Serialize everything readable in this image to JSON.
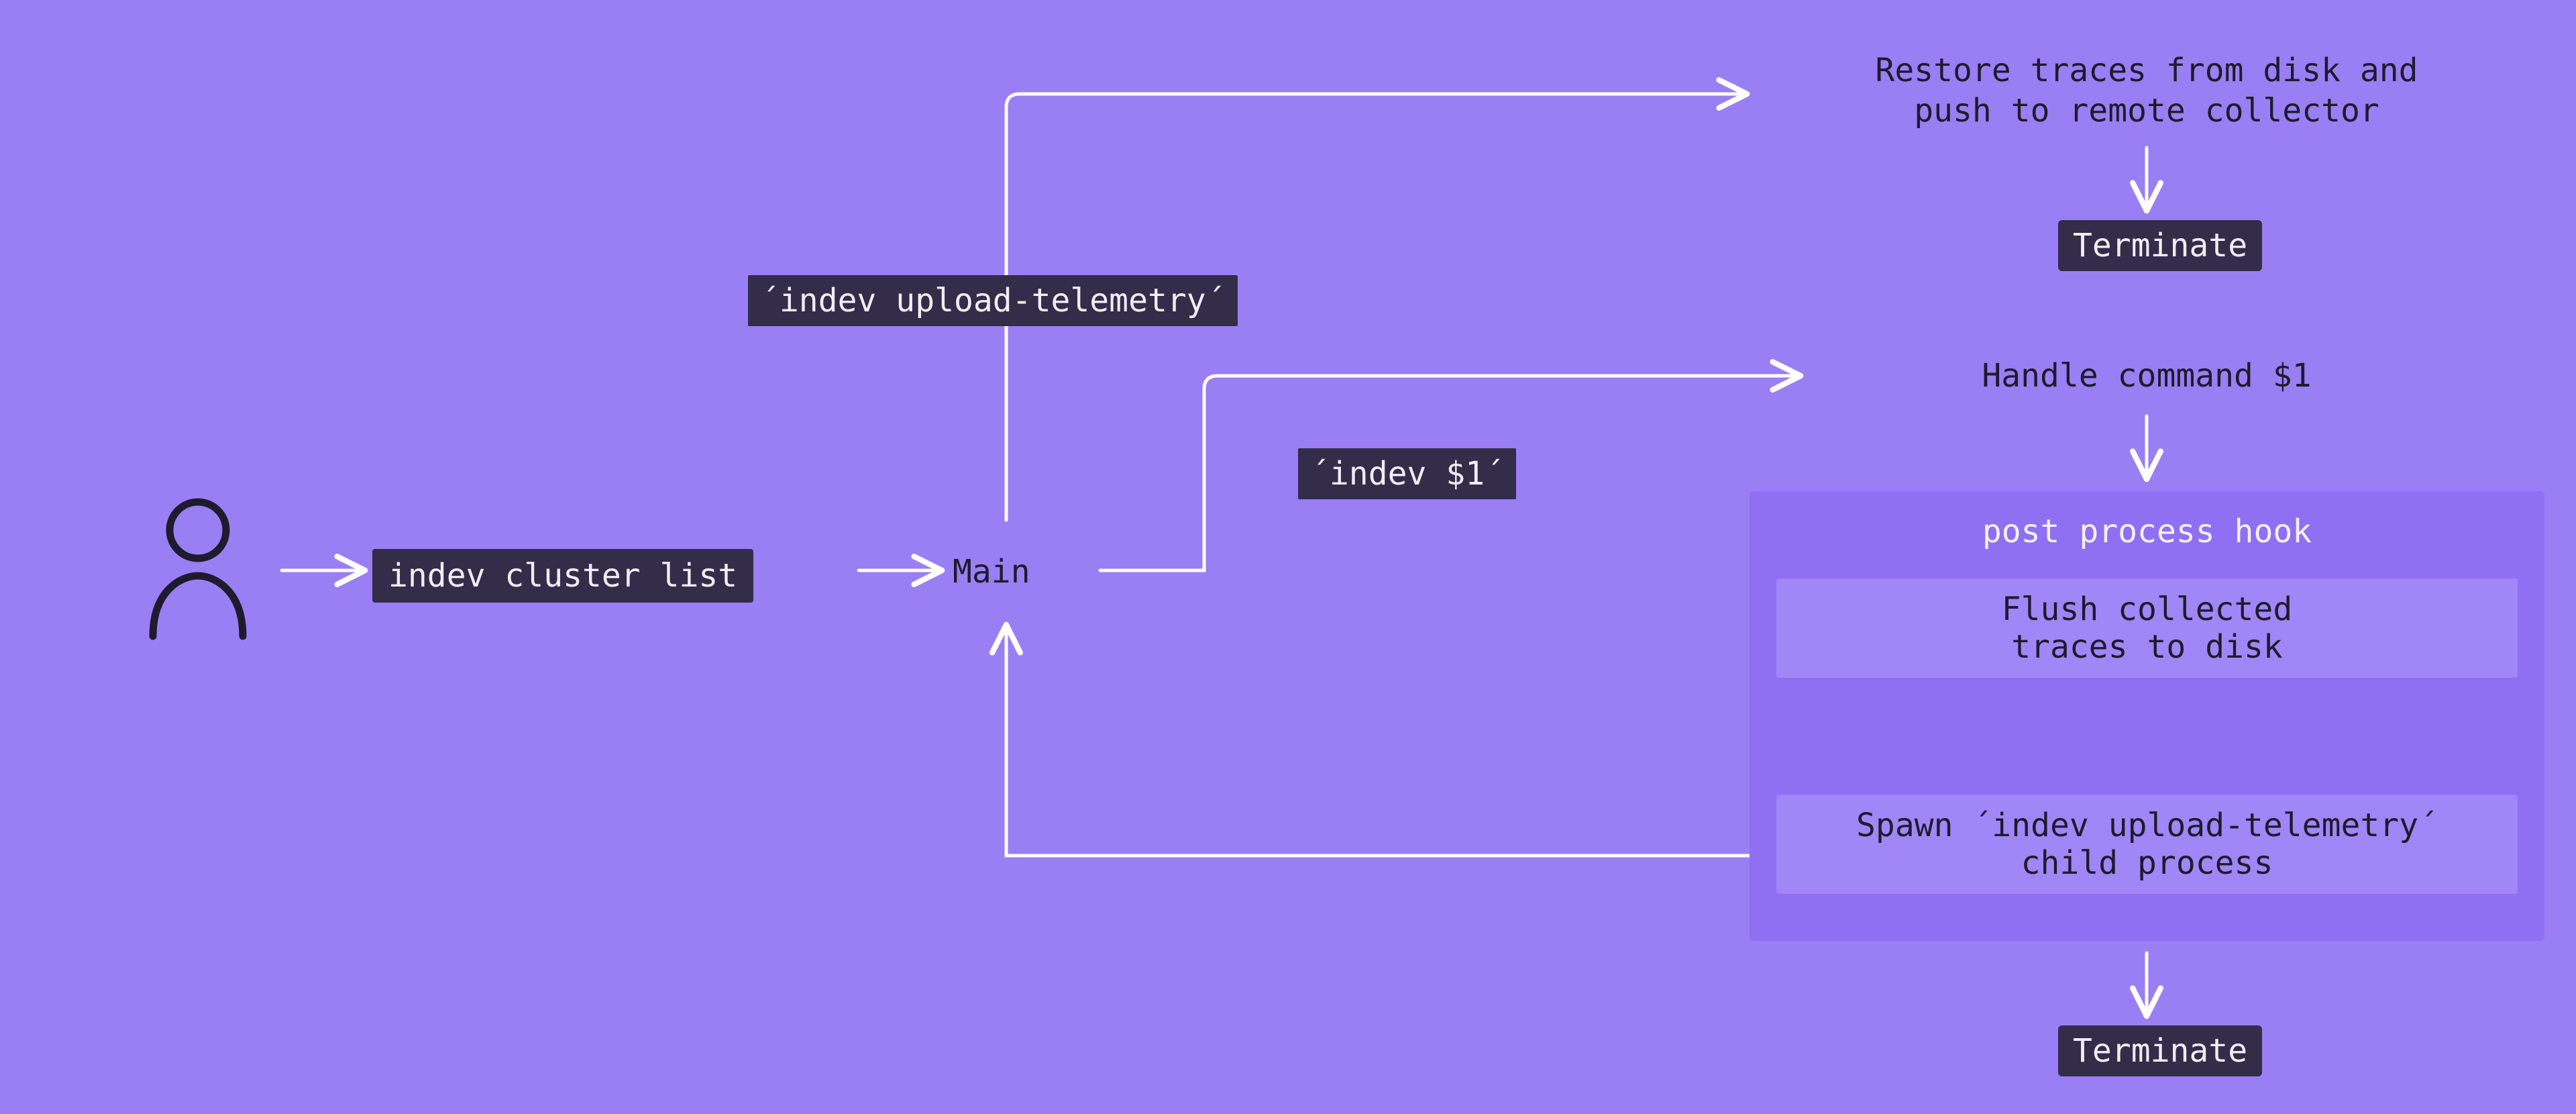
{
  "user_command": "indev cluster list",
  "main_label": "Main",
  "branch_top_label": "´indev upload-telemetry´",
  "branch_mid_label": "´indev $1´",
  "restore_text": "Restore traces from disk and\npush to remote collector",
  "terminate_top": "Terminate",
  "handle_text": "Handle command $1",
  "hook": {
    "title": "post process hook",
    "flush": "Flush collected\ntraces to disk",
    "spawn": "Spawn ´indev upload-telemetry´\nchild process"
  },
  "terminate_bottom": "Terminate"
}
